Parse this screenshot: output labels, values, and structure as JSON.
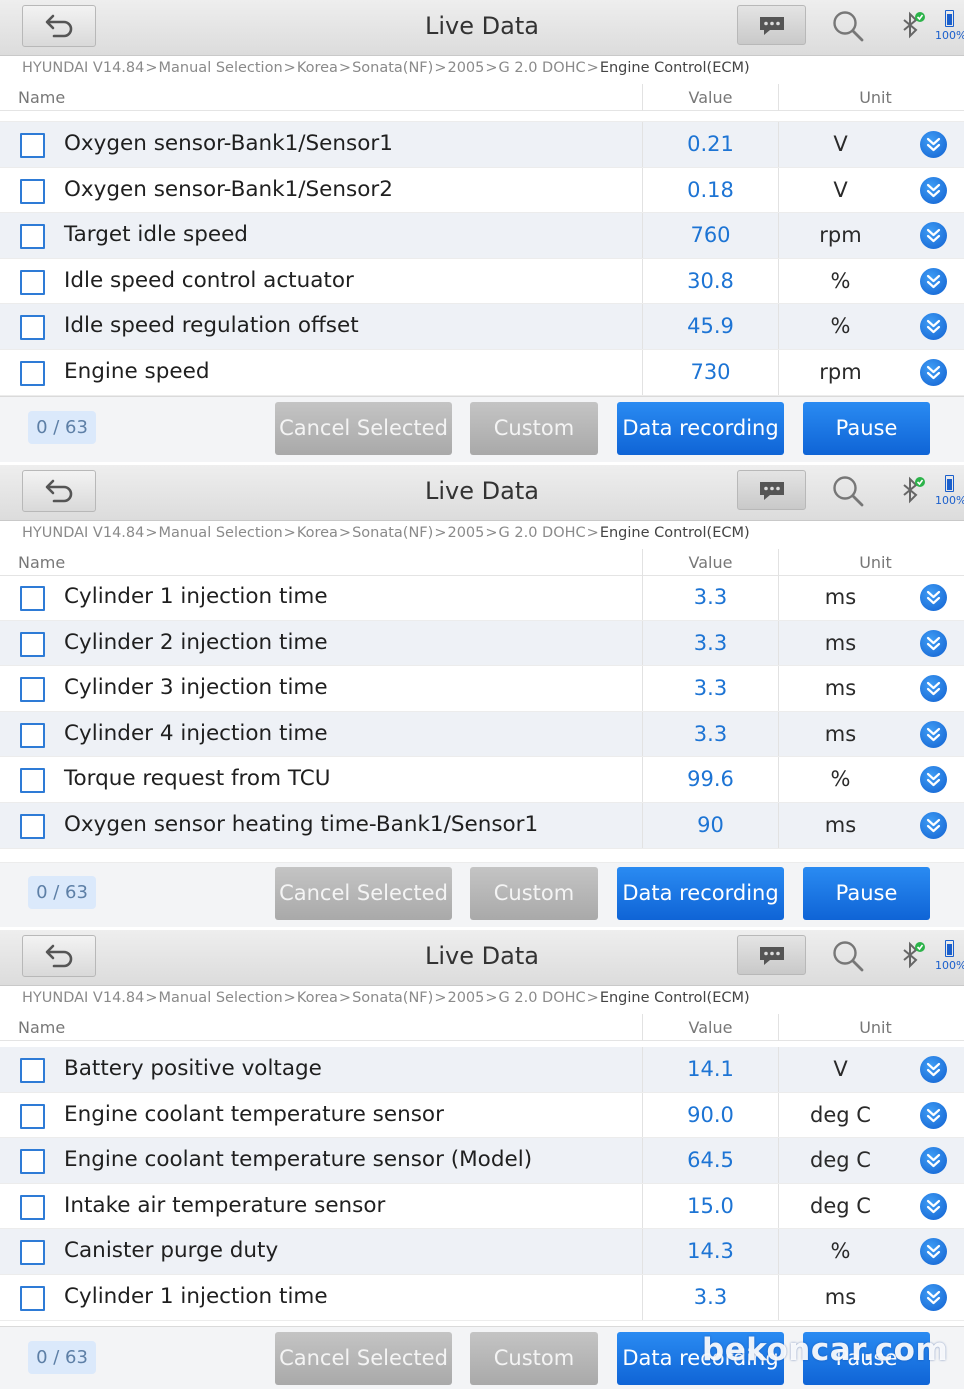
{
  "app": {
    "title": "Live Data",
    "battery_text": "100%",
    "breadcrumb": [
      "HYUNDAI V14.84",
      "Manual Selection",
      "Korea",
      "Sonata(NF)",
      "2005",
      "G 2.0 DOHC",
      "Engine Control(ECM)"
    ],
    "breadcrumb_separator": ">",
    "columns": {
      "name": "Name",
      "value": "Value",
      "unit": "Unit"
    },
    "footer": {
      "count": "0 / 63",
      "cancel_selected": "Cancel Selected",
      "custom": "Custom",
      "data_recording": "Data recording",
      "pause": "Pause"
    },
    "colors": {
      "accent": "#1d74d4",
      "button_blue": "#1a78e8",
      "button_gray": "#b6b6b6",
      "row_shade": "#eef1f6"
    },
    "icons": [
      "back-arrow-icon",
      "message-icon",
      "search-icon",
      "bluetooth-connected-icon",
      "battery-icon",
      "expand-chevron-icon"
    ]
  },
  "screens": [
    {
      "rows": [
        {
          "name": "Oxygen sensor-Bank1/Sensor1",
          "value": "0.21",
          "unit": "V"
        },
        {
          "name": "Oxygen sensor-Bank1/Sensor2",
          "value": "0.18",
          "unit": "V"
        },
        {
          "name": "Target idle speed",
          "value": "760",
          "unit": "rpm"
        },
        {
          "name": "Idle speed control actuator",
          "value": "30.8",
          "unit": "%"
        },
        {
          "name": "Idle speed regulation offset",
          "value": "45.9",
          "unit": "%"
        },
        {
          "name": "Engine speed",
          "value": "730",
          "unit": "rpm"
        }
      ]
    },
    {
      "rows": [
        {
          "name": "Cylinder 1 injection time",
          "value": "3.3",
          "unit": "ms"
        },
        {
          "name": "Cylinder 2 injection time",
          "value": "3.3",
          "unit": "ms"
        },
        {
          "name": "Cylinder 3 injection time",
          "value": "3.3",
          "unit": "ms"
        },
        {
          "name": "Cylinder 4 injection time",
          "value": "3.3",
          "unit": "ms"
        },
        {
          "name": "Torque request from TCU",
          "value": "99.6",
          "unit": "%"
        },
        {
          "name": "Oxygen sensor heating time-Bank1/Sensor1",
          "value": "90",
          "unit": "ms"
        }
      ]
    },
    {
      "rows": [
        {
          "name": "Battery positive voltage",
          "value": "14.1",
          "unit": "V"
        },
        {
          "name": "Engine coolant temperature sensor",
          "value": "90.0",
          "unit": "deg C"
        },
        {
          "name": "Engine coolant temperature sensor (Model)",
          "value": "64.5",
          "unit": "deg C"
        },
        {
          "name": "Intake air temperature sensor",
          "value": "15.0",
          "unit": "deg C"
        },
        {
          "name": "Canister purge duty",
          "value": "14.3",
          "unit": "%"
        },
        {
          "name": "Cylinder 1 injection time",
          "value": "3.3",
          "unit": "ms"
        }
      ]
    }
  ],
  "watermark": "bekoncar.com"
}
